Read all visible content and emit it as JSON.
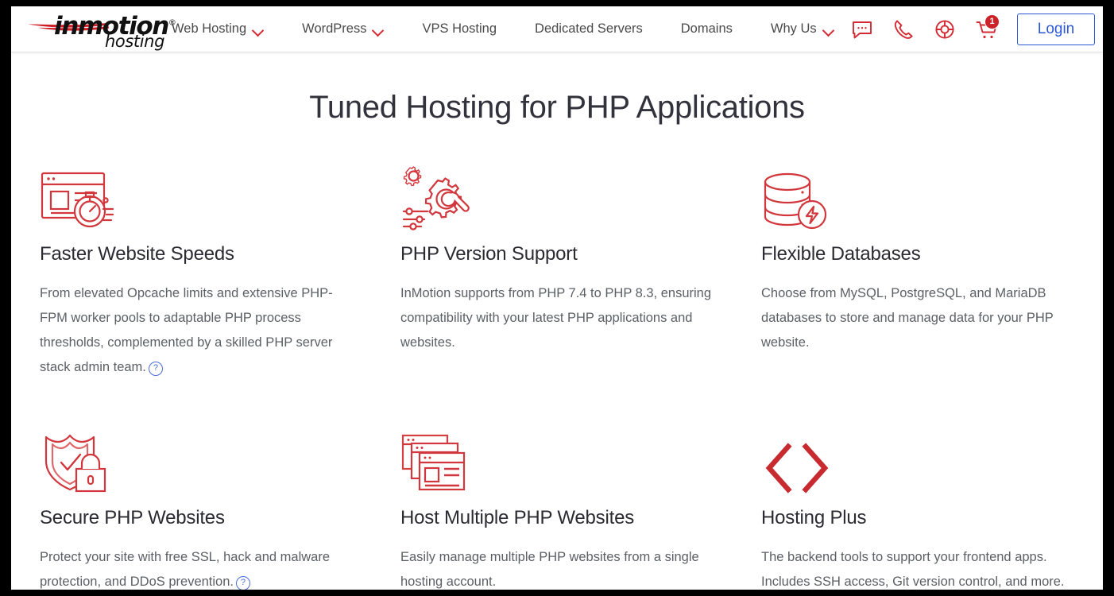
{
  "header": {
    "logo": {
      "word": "inmotion",
      "registered": "®",
      "sub": "hosting",
      "swoosh": "red-swoosh-icon"
    },
    "nav": [
      {
        "label": "Web Hosting",
        "has_chevron": true
      },
      {
        "label": "WordPress",
        "has_chevron": true
      },
      {
        "label": "VPS Hosting",
        "has_chevron": false
      },
      {
        "label": "Dedicated Servers",
        "has_chevron": false
      },
      {
        "label": "Domains",
        "has_chevron": false
      },
      {
        "label": "Why Us",
        "has_chevron": true
      }
    ],
    "icons": [
      {
        "name": "chat-icon"
      },
      {
        "name": "phone-icon"
      },
      {
        "name": "life-ring-support-icon"
      },
      {
        "name": "cart-icon",
        "badge": "1"
      }
    ],
    "login_label": "Login",
    "accent_color": "#d32a33",
    "login_color": "#2b59d6"
  },
  "main": {
    "title": "Tuned Hosting for PHP Applications",
    "cards": [
      {
        "icon": "browser-stopwatch-icon",
        "title": "Faster Website Speeds",
        "text": "From elevated Opcache limits and extensive PHP-FPM worker pools to adaptable PHP process thresholds, complemented by a skilled PHP server stack admin team.",
        "help": "?"
      },
      {
        "icon": "gears-wrench-sliders-icon",
        "title": "PHP Version Support",
        "text": "InMotion supports from PHP 7.4 to PHP 8.3, ensuring compatibility with your latest PHP applications and websites.",
        "help": ""
      },
      {
        "icon": "database-bolt-icon",
        "title": "Flexible Databases",
        "text": "Choose from MySQL, PostgreSQL, and MariaDB databases to store and manage data for your PHP website.",
        "help": ""
      },
      {
        "icon": "shield-lock-icon",
        "title": "Secure PHP Websites",
        "text": "Protect your site with free SSL, hack and malware protection, and DDoS prevention.",
        "help": "?"
      },
      {
        "icon": "stacked-browser-windows-icon",
        "title": "Host Multiple PHP Websites",
        "text": "Easily manage multiple PHP websites from a single hosting account.",
        "help": ""
      },
      {
        "icon": "code-brackets-icon",
        "title": "Hosting Plus",
        "text": "The backend tools to support your frontend apps. Includes SSH access, Git version control, and more.",
        "help": ""
      }
    ]
  }
}
